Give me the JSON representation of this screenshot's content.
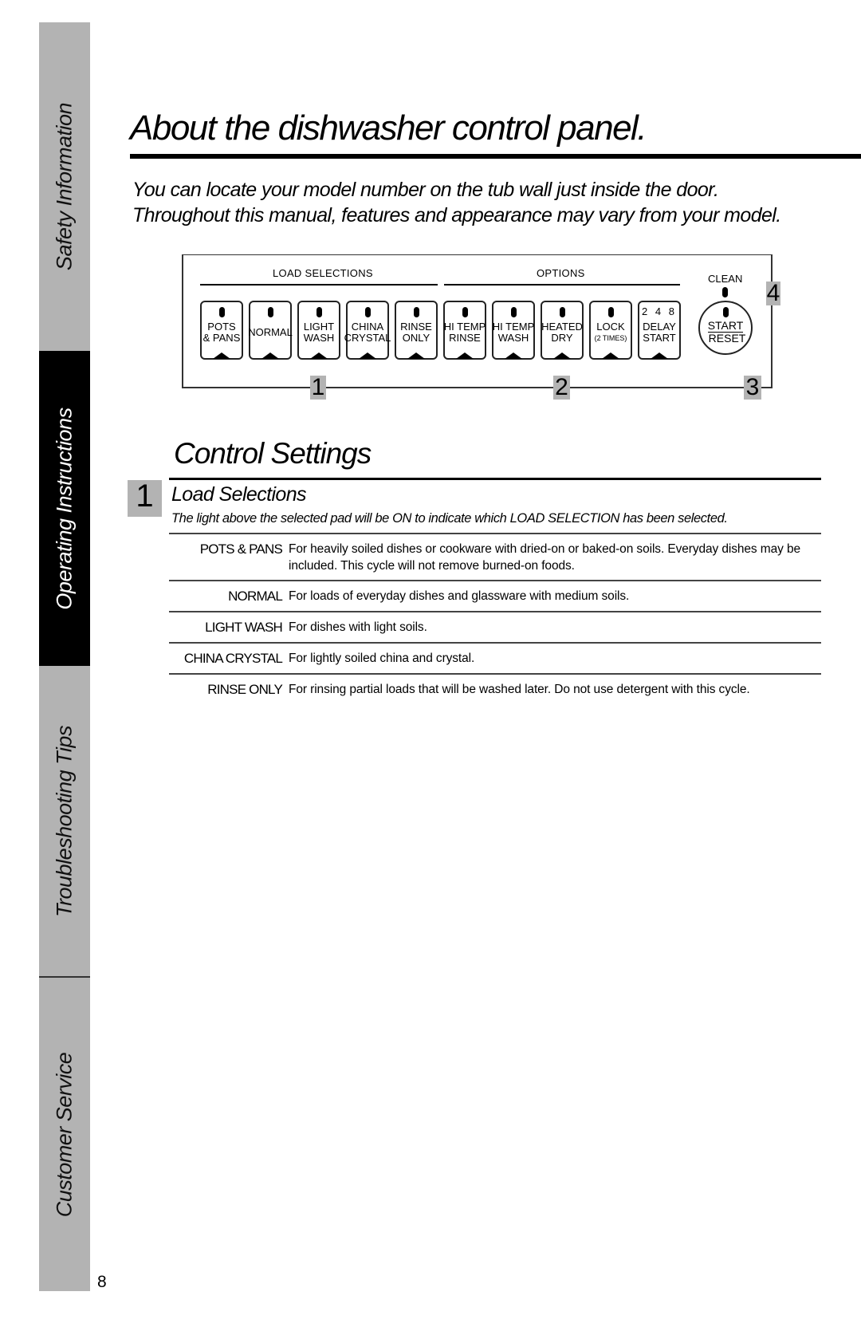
{
  "sidebar": {
    "tabs": [
      {
        "label": "Safety Information",
        "active": false
      },
      {
        "label": "Operating Instructions",
        "active": true
      },
      {
        "label": "Troubleshooting Tips",
        "active": false
      },
      {
        "label": "Customer Service",
        "active": false
      }
    ]
  },
  "page_number": "8",
  "header": {
    "title": "About the dishwasher control panel.",
    "intro_line1": "You can locate your model number on the tub wall just inside the door.",
    "intro_line2": "Throughout this manual, features and appearance may vary from your model."
  },
  "panel": {
    "load_selections_label": "LOAD SELECTIONS",
    "options_label": "OPTIONS",
    "clean_label": "CLEAN",
    "pads": [
      {
        "line1": "POTS",
        "line2": "& PANS"
      },
      {
        "single": "NORMAL"
      },
      {
        "line1": "LIGHT",
        "line2": "WASH"
      },
      {
        "line1": "CHINA",
        "line2": "CRYSTAL"
      },
      {
        "line1": "RINSE",
        "line2": "ONLY"
      },
      {
        "line1": "HI TEMP",
        "line2": "RINSE"
      },
      {
        "line1": "HI TEMP",
        "line2": "WASH"
      },
      {
        "line1": "HEATED",
        "line2": "DRY"
      },
      {
        "line1": "LOCK",
        "line2": "(2 TIMES)"
      },
      {
        "digits": "2 4 8",
        "line1": "DELAY",
        "line2": "START"
      }
    ],
    "start_button": {
      "line1": "START",
      "line2": "RESET"
    },
    "callouts": [
      "1",
      "2",
      "3",
      "4"
    ]
  },
  "control_settings": {
    "title": "Control Settings",
    "section_number": "1",
    "subtitle": "Load Selections",
    "description": "The light above the selected pad will be ON to indicate which LOAD SELECTION has been selected.",
    "rows": [
      {
        "term": "POTS & PANS",
        "definition": "For heavily soiled dishes or cookware with dried-on or baked-on soils. Everyday dishes may be included. This cycle will not remove burned-on foods."
      },
      {
        "term": "NORMAL",
        "definition": "For loads of everyday dishes and glassware with medium soils."
      },
      {
        "term": "LIGHT WASH",
        "definition": "For dishes with light soils."
      },
      {
        "term": "CHINA CRYSTAL",
        "definition": "For lightly soiled china and crystal."
      },
      {
        "term": "RINSE ONLY",
        "definition": "For rinsing partial loads that will be washed later. Do not use detergent with this cycle."
      }
    ]
  }
}
